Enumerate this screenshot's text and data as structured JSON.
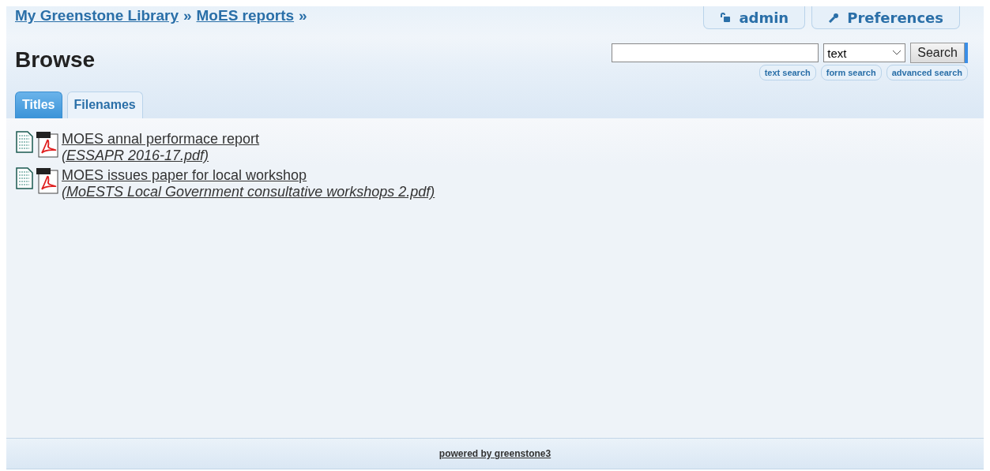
{
  "breadcrumbs": [
    {
      "label": "My Greenstone Library"
    },
    {
      "label": "MoES reports"
    }
  ],
  "breadcrumb_separator": "»",
  "user_links": [
    {
      "kind": "login",
      "label": "admin"
    },
    {
      "kind": "preferences",
      "label": "Preferences"
    }
  ],
  "title": "Browse",
  "search": {
    "index": "text",
    "button": "Search",
    "links": [
      "text search",
      "form search",
      "advanced search"
    ]
  },
  "tabs": [
    {
      "label": "Titles",
      "selected": true
    },
    {
      "label": "Filenames",
      "selected": false
    }
  ],
  "documents": [
    {
      "title": "MOES annal performace report",
      "filename": "(ESSAPR 2016-17.pdf)"
    },
    {
      "title": "MOES issues paper for local workshop",
      "filename": "(MoESTS Local Government consultative workshops 2.pdf)"
    }
  ],
  "footer": "powered by greenstone3"
}
